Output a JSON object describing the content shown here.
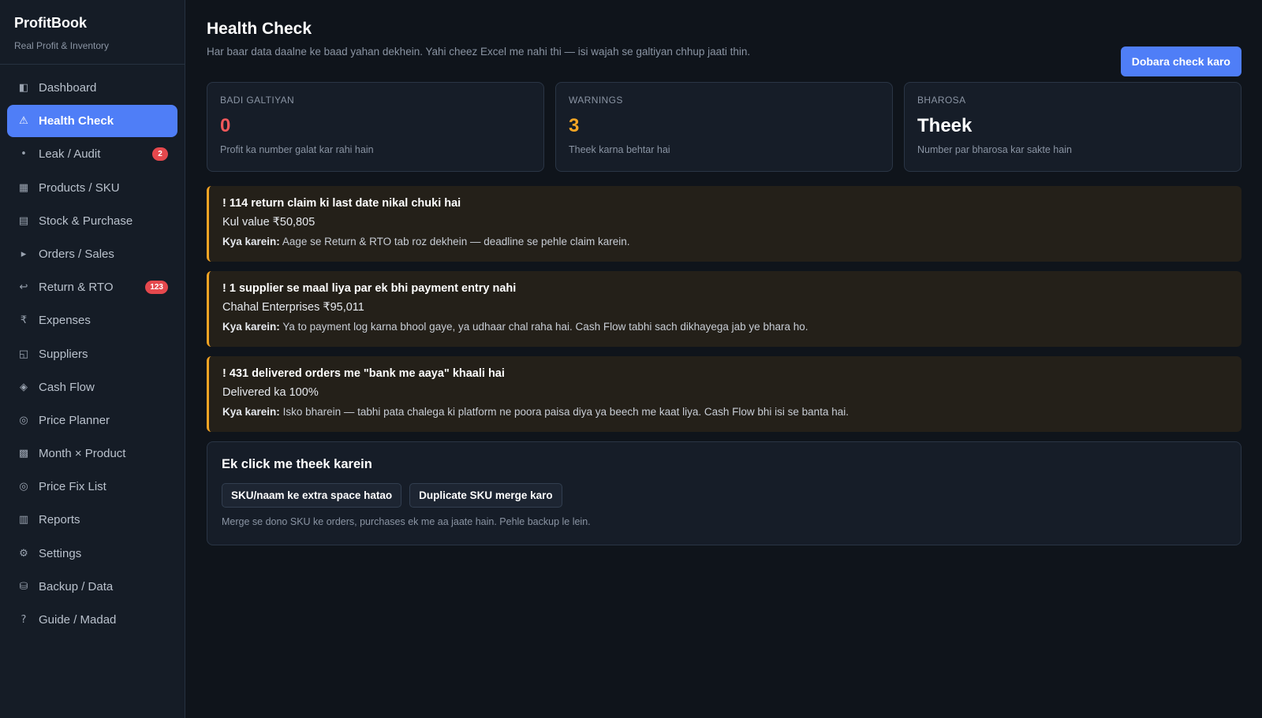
{
  "brand": {
    "title": "ProfitBook",
    "subtitle": "Real Profit & Inventory"
  },
  "sidebar": {
    "items": [
      {
        "icon": "dashboard-icon",
        "glyph": "◧",
        "label": "Dashboard",
        "active": false
      },
      {
        "icon": "warning-icon",
        "glyph": "⚠",
        "label": "Health Check",
        "active": true
      },
      {
        "icon": "dot-icon",
        "glyph": "•",
        "label": "Leak / Audit",
        "badge": "2"
      },
      {
        "icon": "grid-icon",
        "glyph": "▦",
        "label": "Products / SKU"
      },
      {
        "icon": "list-icon",
        "glyph": "▤",
        "label": "Stock & Purchase"
      },
      {
        "icon": "play-icon",
        "glyph": "▸",
        "label": "Orders / Sales"
      },
      {
        "icon": "return-icon",
        "glyph": "↩",
        "label": "Return & RTO",
        "badge": "123"
      },
      {
        "icon": "rupee-icon",
        "glyph": "₹",
        "label": "Expenses"
      },
      {
        "icon": "suppliers-icon",
        "glyph": "◱",
        "label": "Suppliers"
      },
      {
        "icon": "diamond-icon",
        "glyph": "◈",
        "label": "Cash Flow"
      },
      {
        "icon": "target-icon",
        "glyph": "◎",
        "label": "Price Planner"
      },
      {
        "icon": "matrix-icon",
        "glyph": "▩",
        "label": "Month × Product"
      },
      {
        "icon": "target-icon",
        "glyph": "◎",
        "label": "Price Fix List"
      },
      {
        "icon": "reports-icon",
        "glyph": "▥",
        "label": "Reports"
      },
      {
        "icon": "gear-icon",
        "glyph": "⚙",
        "label": "Settings"
      },
      {
        "icon": "database-icon",
        "glyph": "⛁",
        "label": "Backup / Data"
      },
      {
        "icon": "help-icon",
        "glyph": "?",
        "label": "Guide / Madad"
      }
    ]
  },
  "header": {
    "title": "Health Check",
    "subtitle": "Har baar data daalne ke baad yahan dekhein. Yahi cheez Excel me nahi thi — isi wajah se galtiyan chhup jaati thin.",
    "recheck_label": "Dobara check karo"
  },
  "stats": [
    {
      "label": "BADI GALTIYAN",
      "value": "0",
      "desc": "Profit ka number galat kar rahi hain",
      "color": "#f0585b"
    },
    {
      "label": "WARNINGS",
      "value": "3",
      "desc": "Theek karna behtar hai",
      "color": "#f5a524"
    },
    {
      "label": "BHAROSA",
      "value": "Theek",
      "desc": "Number par bharosa kar sakte hain",
      "color": "#ffffff"
    }
  ],
  "alerts": [
    {
      "title": "! 114 return claim ki last date nikal chuki hai",
      "value": "Kul value ₹50,805",
      "action_prefix": "Kya karein:",
      "action": "Aage se Return & RTO tab roz dekhein — deadline se pehle claim karein."
    },
    {
      "title": "! 1 supplier se maal liya par ek bhi payment entry nahi",
      "value": "Chahal Enterprises ₹95,011",
      "action_prefix": "Kya karein:",
      "action": "Ya to payment log karna bhool gaye, ya udhaar chal raha hai. Cash Flow tabhi sach dikhayega jab ye bhara ho."
    },
    {
      "title": "! 431 delivered orders me \"bank me aaya\" khaali hai",
      "value": "Delivered ka 100%",
      "action_prefix": "Kya karein:",
      "action": "Isko bharein — tabhi pata chalega ki platform ne poora paisa diya ya beech me kaat liya. Cash Flow bhi isi se banta hai."
    }
  ],
  "fix": {
    "title": "Ek click me theek karein",
    "trim_label": "SKU/naam ke extra space hatao",
    "merge_label": "Duplicate SKU merge karo",
    "note": "Merge se dono SKU ke orders, purchases ek me aa jaate hain. Pehle backup le lein."
  },
  "colors": {
    "accent": "#4f7ef7",
    "warning": "#f5a524",
    "error": "#f0585b"
  }
}
